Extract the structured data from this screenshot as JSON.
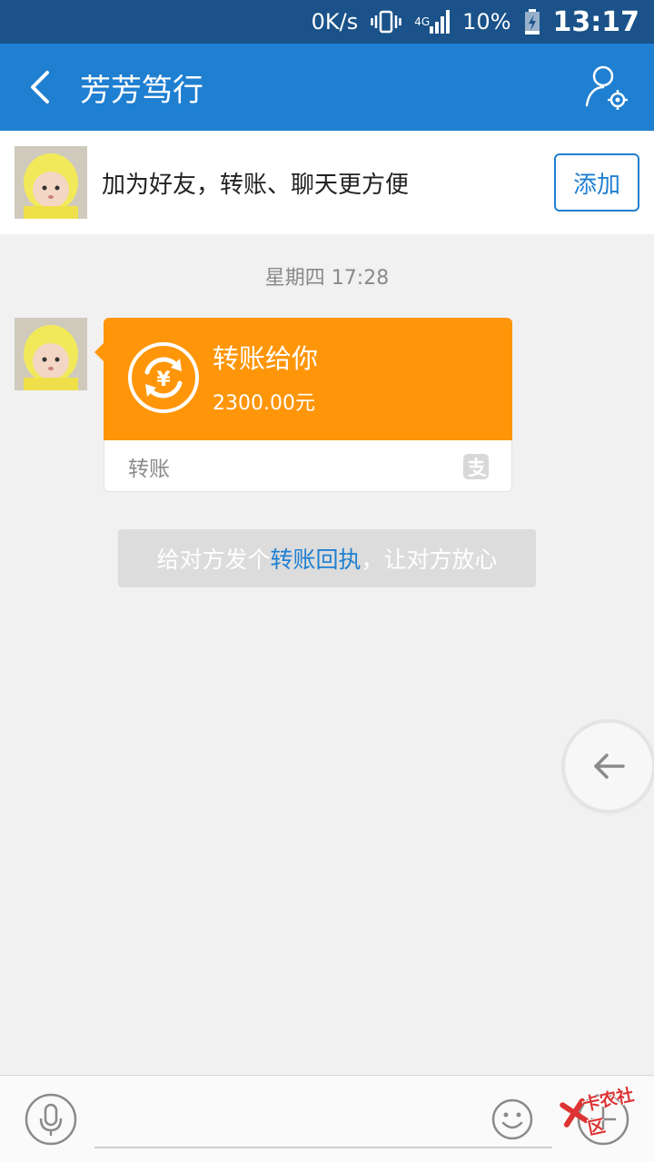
{
  "status_bar": {
    "net_speed": "0K/s",
    "network": "4G",
    "battery": "10%",
    "time": "13:17"
  },
  "header": {
    "title": "芳芳笃行",
    "back_icon": "chevron-left-icon",
    "settings_icon": "profile-settings-icon"
  },
  "friend_banner": {
    "text": "加为好友，转账、聊天更方便",
    "add_label": "添加"
  },
  "conversation": {
    "timestamp": "星期四 17:28",
    "transfer": {
      "title": "转账给你",
      "amount": "2300.00元",
      "type_label": "转账",
      "accent_color": "#ff960a"
    },
    "receipt_hint": {
      "prefix": "给对方发个",
      "link": "转账回执",
      "suffix": "，让对方放心"
    }
  },
  "input_bar": {
    "placeholder": "",
    "watermark": "卡农社区"
  },
  "colors": {
    "primary": "#1f7fd1",
    "status_bar": "#1a5289",
    "background": "#f1f1f2"
  }
}
